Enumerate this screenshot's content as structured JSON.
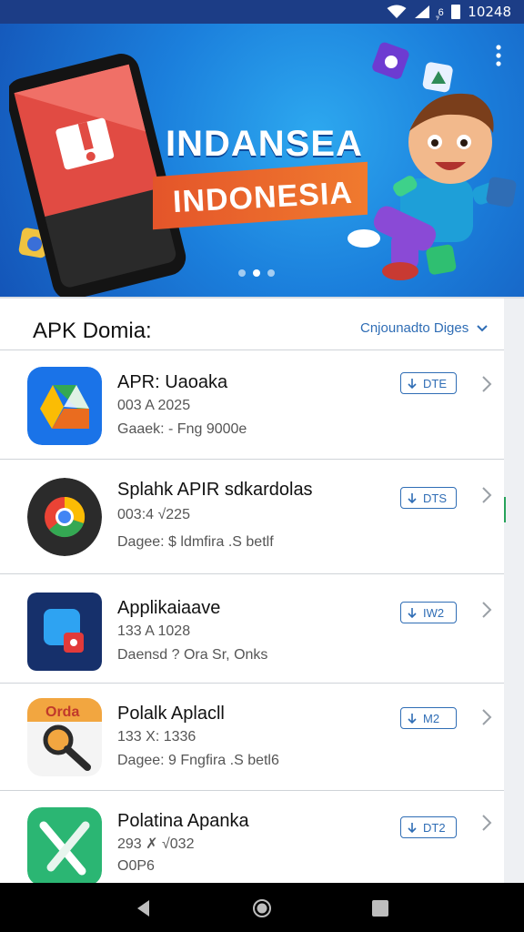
{
  "status_bar": {
    "carrier_text": "᪸᪹6",
    "time": "10248"
  },
  "hero": {
    "title_line1": "INDANSEA",
    "title_line2": "INDONESIA",
    "dots": 3,
    "active_dot": 1
  },
  "panel": {
    "title": "APK Domia:",
    "filter_label": "Cnjounadto Diges"
  },
  "apps": [
    {
      "name": "APR: Uaoaka",
      "date": "003 A 2025",
      "meta": "Gaaek: - Fng 9000e",
      "badge": "DTE",
      "icon": "google-drive-icon",
      "color": "#1a73e8"
    },
    {
      "name": "Splahk APIR sdkardolas",
      "date": "003:4 √225",
      "meta": "Dagee: $ ldmfira .S betlf",
      "badge": "DTS",
      "icon": "chrome-icon",
      "color": "#2b2b2b"
    },
    {
      "name": "Applikaiaave",
      "date": "133 A 1028",
      "meta": "Daensd ? Ora Sr, Onks",
      "badge": "IW2",
      "icon": "app-window-icon",
      "color": "#16306b"
    },
    {
      "name": "Polalk Aplacll",
      "date": "133 X: 1336",
      "meta": "Dagee: 9 Fngfira .S betl6",
      "badge": "M2",
      "icon": "search-magnifier-icon",
      "color": "#f2a640"
    },
    {
      "name": "Polatina Apanka",
      "date": "293 ✗ √032",
      "meta": "O0P6",
      "badge": "DT2",
      "icon": "tools-icon",
      "color": "#2bb673"
    }
  ],
  "colors": {
    "accent": "#2f6db5",
    "status_bar": "#1c3d86",
    "hero": "#1b7fdc",
    "ribbon": "#e4552a"
  }
}
